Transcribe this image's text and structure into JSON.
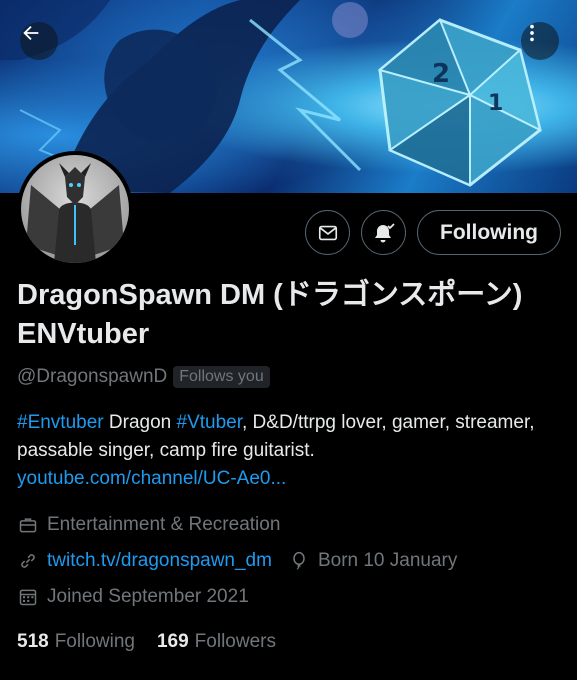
{
  "profile": {
    "display_name": "DragonSpawn DM (ドラゴンスポーン) ENVtuber",
    "handle": "@DragonspawnD",
    "follows_you": "Follows you",
    "bio": {
      "tag1": "#Envtuber",
      "text1": " Dragon ",
      "tag2": "#Vtuber",
      "text2": ", D&D/ttrpg lover, gamer, streamer, passable singer, camp fire guitarist.",
      "link": "youtube.com/channel/UC-Ae0..."
    },
    "category": "Entertainment & Recreation",
    "website": "twitch.tv/dragonspawn_dm",
    "born": "Born 10 January",
    "joined": "Joined September 2021"
  },
  "stats": {
    "following_count": "518",
    "following_label": "Following",
    "followers_count": "169",
    "followers_label": "Followers"
  },
  "actions": {
    "follow_label": "Following"
  },
  "icons": {
    "back": "arrow-left-icon",
    "more": "more-vertical-icon",
    "mail": "mail-icon",
    "bell": "bell-check-icon",
    "category": "briefcase-icon",
    "website": "link-icon",
    "born": "balloon-icon",
    "joined": "calendar-icon"
  },
  "colors": {
    "background": "#000000",
    "text": "#e7e9ea",
    "muted": "#71767b",
    "accent": "#1d9bf0",
    "border": "#536471"
  }
}
